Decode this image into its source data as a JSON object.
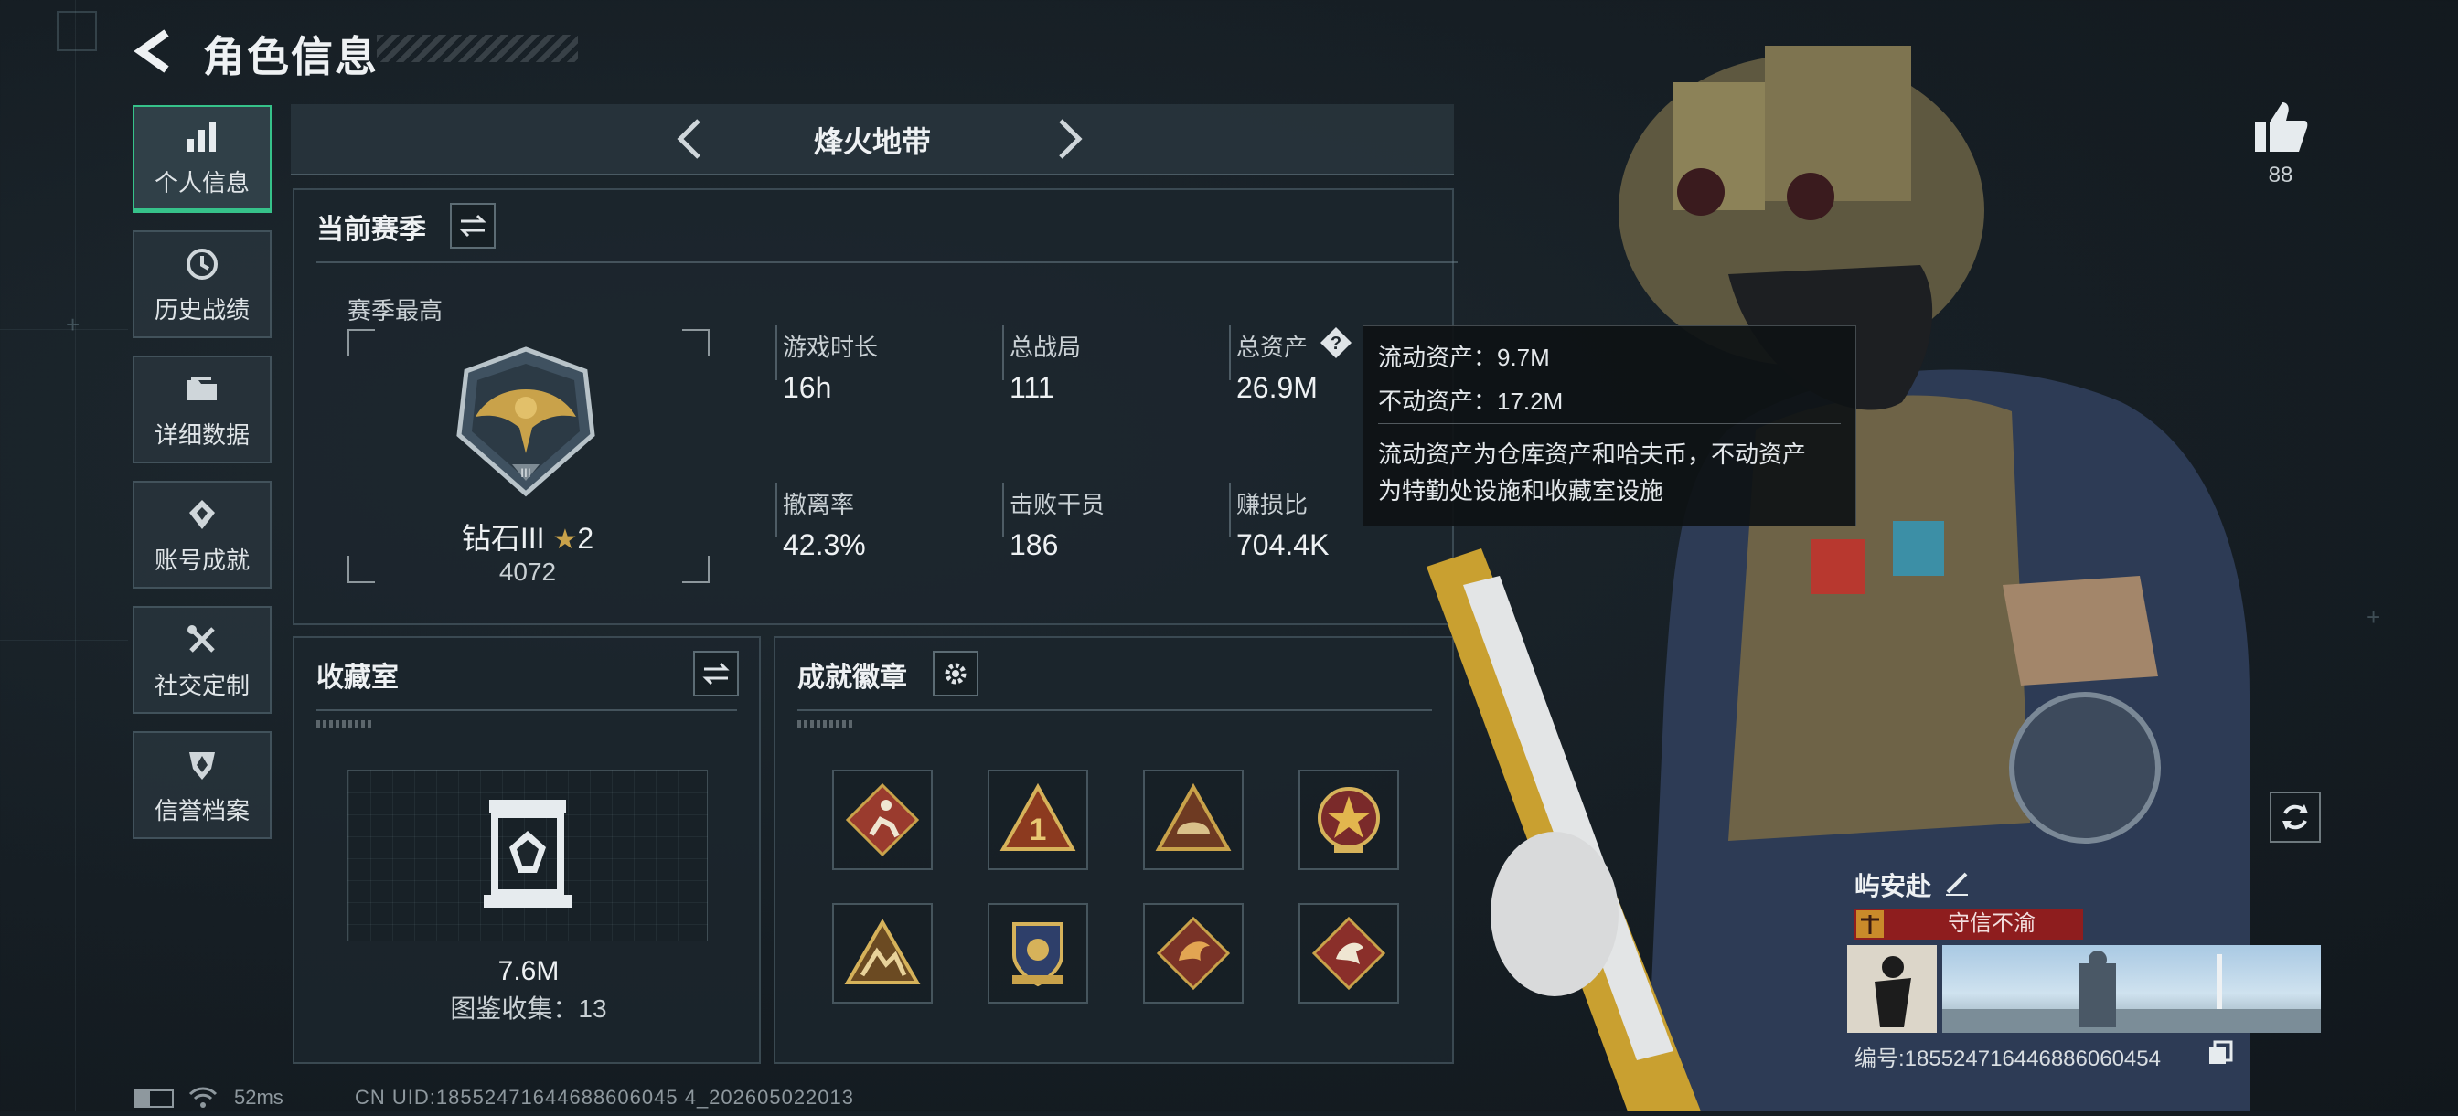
{
  "header": {
    "title": "角色信息"
  },
  "sidebar": {
    "items": [
      {
        "label": "个人信息",
        "icon": "bar-chart-icon",
        "active": true
      },
      {
        "label": "历史战绩",
        "icon": "history-clock-icon",
        "active": false
      },
      {
        "label": "详细数据",
        "icon": "folder-icon",
        "active": false
      },
      {
        "label": "账号成就",
        "icon": "achievement-medal-icon",
        "active": false
      },
      {
        "label": "社交定制",
        "icon": "tools-icon",
        "active": false
      },
      {
        "label": "信誉档案",
        "icon": "shield-emblem-icon",
        "active": false
      }
    ]
  },
  "mode": {
    "name": "烽火地带"
  },
  "season": {
    "title": "当前赛季",
    "best_label": "赛季最高",
    "rank": "钻石III",
    "stars": "2",
    "points": "4072",
    "stats": [
      {
        "label": "游戏时长",
        "value": "16h"
      },
      {
        "label": "总战局",
        "value": "111"
      },
      {
        "label": "总资产",
        "value": "26.9M"
      },
      {
        "label": "撤离率",
        "value": "42.3%"
      },
      {
        "label": "击败干员",
        "value": "186"
      },
      {
        "label": "赚损比",
        "value": "704.4K"
      }
    ]
  },
  "tooltip": {
    "liquid": "流动资产：9.7M",
    "fixed": "不动资产：17.2M",
    "desc_line1": "流动资产为仓库资产和哈夫币，不动资产",
    "desc_line2": "为特勤处设施和收藏室设施"
  },
  "collection": {
    "title": "收藏室",
    "value": "7.6M",
    "count_label": "图鉴收集：13"
  },
  "badges": {
    "title": "成就徽章",
    "items": [
      "runner-badge-icon",
      "number-one-badge-icon",
      "helmet-badge-icon",
      "star-cross-badge-icon",
      "mountain-badge-icon",
      "shield-crest-badge-icon",
      "dragon-badge-icon",
      "bird-badge-icon"
    ]
  },
  "likes": {
    "count": "88"
  },
  "player": {
    "name": "屿安赴",
    "title": "守信不渝",
    "id_label": "编号:1855247164468860604​54"
  },
  "footer": {
    "ping": "52ms",
    "uid": "CN UID:18552471644688606045 4_202605022013"
  },
  "colors": {
    "accent_green": "#36c28a",
    "title_red": "#8e1d1e",
    "gold": "#c9a24a"
  }
}
